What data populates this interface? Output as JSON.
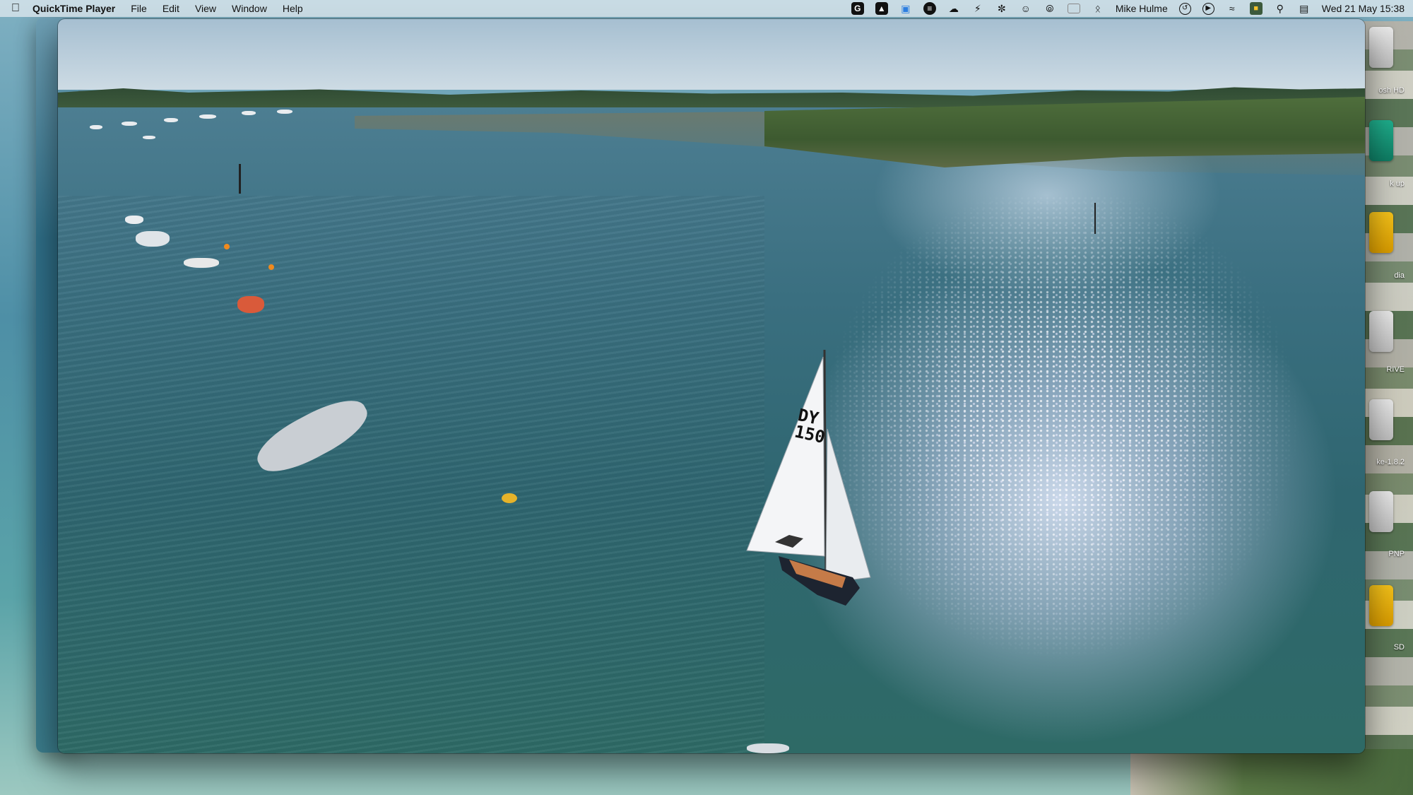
{
  "menubar": {
    "app_name": "QuickTime Player",
    "menus": [
      "File",
      "Edit",
      "View",
      "Window",
      "Help"
    ],
    "user_name": "Mike Hulme",
    "datetime": "Wed 21 May  15:38",
    "status_icons": [
      "grammarly-icon",
      "drive-icon",
      "finder-sync-icon",
      "audio-hijack-icon",
      "weather-icon",
      "bolt-icon",
      "chatgpt-icon",
      "face-icon",
      "airdrop-icon",
      "screen-mirror-icon",
      "bluetooth-icon",
      "user-icon",
      "time-machine-icon",
      "play-icon",
      "wifi-icon",
      "display-icon",
      "spotlight-icon",
      "control-center-icon"
    ]
  },
  "desktop": {
    "labels": [
      "osh HD",
      "k up",
      "dia",
      "RIVE",
      "ke-1.8.2",
      "PNP",
      "SD"
    ]
  },
  "video": {
    "sail_number": "DY\n150"
  }
}
